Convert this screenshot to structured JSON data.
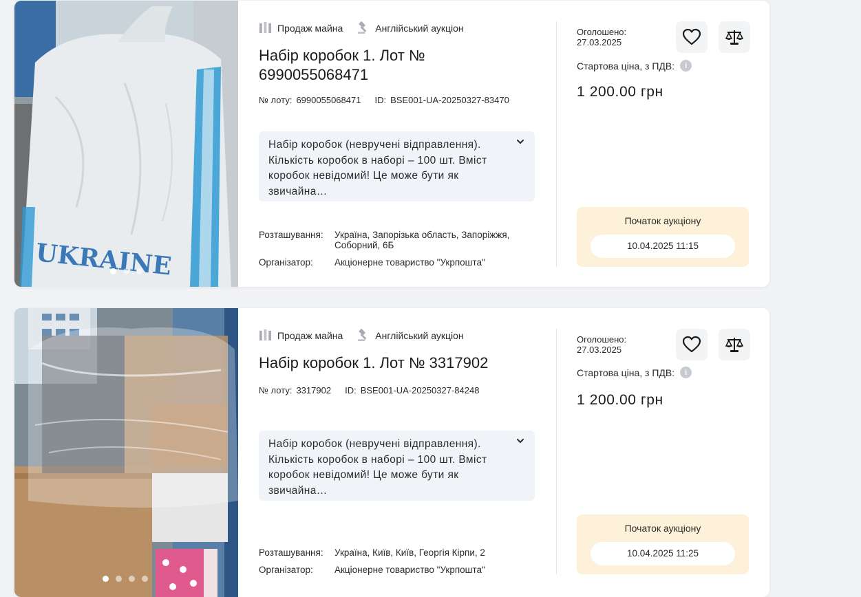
{
  "lots": [
    {
      "category": "Продаж майна",
      "auction_type": "Англійський аукціон",
      "title": "Набір коробок 1. Лот № 6990055068471",
      "lot_label": "№ лоту:",
      "lot_number": "6990055068471",
      "id_label": "ID:",
      "id_value": "BSE001-UA-20250327-83470",
      "description": "Набір коробок (неврученi відправлення). Кількість коробок в наборі – 100 шт. Вміст коробок невідомий! Це може бути як звичайна…",
      "location_label": "Розташування:",
      "location": "Україна, Запорізька область, Запоріжжя, Соборний, 6Б",
      "organizer_label": "Організатор:",
      "organizer": "Акціонерне товариство \"Укрпошта\"",
      "announced_label": "Оголошено:",
      "announced_date": "27.03.2025",
      "vat_label": "Стартова ціна, з ПДВ:",
      "price": "1 200.00 грн",
      "auction_start_label": "Початок аукціону",
      "auction_start": "10.04.2025 11:15",
      "photo_count": 3,
      "active_photo": 0
    },
    {
      "category": "Продаж майна",
      "auction_type": "Англійський аукціон",
      "title": "Набір коробок 1. Лот № 3317902",
      "lot_label": "№ лоту:",
      "lot_number": "3317902",
      "id_label": "ID:",
      "id_value": "BSE001-UA-20250327-84248",
      "description": "Набір коробок (невручені відправлення). Кількість коробок в наборі – 100 шт. Вміст коробок невідомий! Це може бути як звичайна…",
      "location_label": "Розташування:",
      "location": "Україна, Київ, Київ, Георгія Кірпи, 2",
      "organizer_label": "Організатор:",
      "organizer": "Акціонерне товариство \"Укрпошта\"",
      "announced_label": "Оголошено:",
      "announced_date": "27.03.2025",
      "vat_label": "Стартова ціна, з ПДВ:",
      "price": "1 200.00 грн",
      "auction_start_label": "Початок аукціону",
      "auction_start": "10.04.2025 11:25",
      "photo_count": 4,
      "active_photo": 0
    }
  ],
  "photo1_bag_text": "UKRAINE",
  "icons": {
    "category": "building-columns-icon",
    "auction": "gavel-icon",
    "favorite": "heart-icon",
    "compare": "scales-icon",
    "info": "info-icon",
    "expand": "chevron-down-icon"
  },
  "colors": {
    "page_bg": "#f1f2f4",
    "card_bg": "#ffffff",
    "description_bg": "#f0f4f8",
    "auction_box_bg": "#fdf1d9",
    "text": "#1b1b1b"
  }
}
